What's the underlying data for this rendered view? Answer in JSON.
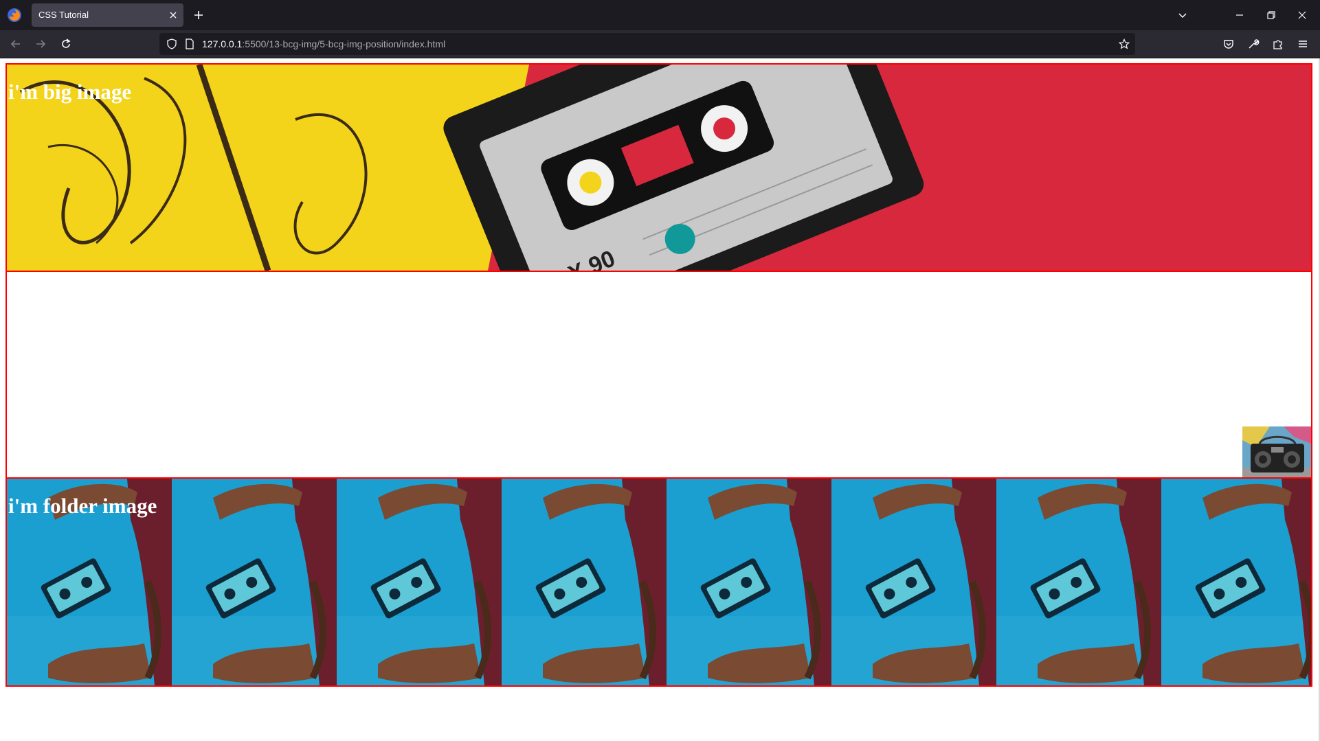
{
  "browser": {
    "tab_title": "CSS Tutorial",
    "url_host": "127.0.0.1",
    "url_rest": ":5500/13-bcg-img/5-bcg-img-position/index.html"
  },
  "icons": [
    "firefox-logo-icon",
    "close-icon",
    "plus-icon",
    "chevron-down-icon",
    "minimize-icon",
    "restore-icon",
    "close-window-icon",
    "back-arrow-icon",
    "forward-arrow-icon",
    "reload-icon",
    "shield-icon",
    "page-icon",
    "star-icon",
    "pocket-icon",
    "wrench-icon",
    "extensions-icon",
    "menu-icon"
  ],
  "page": {
    "big_box": {
      "heading": "i'm big image",
      "image": "cassette-tape-on-yellow-and-red"
    },
    "middle_box": {
      "image": "boombox-against-graffiti-wall"
    },
    "folder_box": {
      "heading": "i'm folder image",
      "image": "hand-catching-cassette-tile"
    }
  },
  "colors": {
    "border": "#ff0000",
    "yellow": "#f4d41a",
    "red": "#d8283d",
    "sky": "#1a9fd0"
  }
}
